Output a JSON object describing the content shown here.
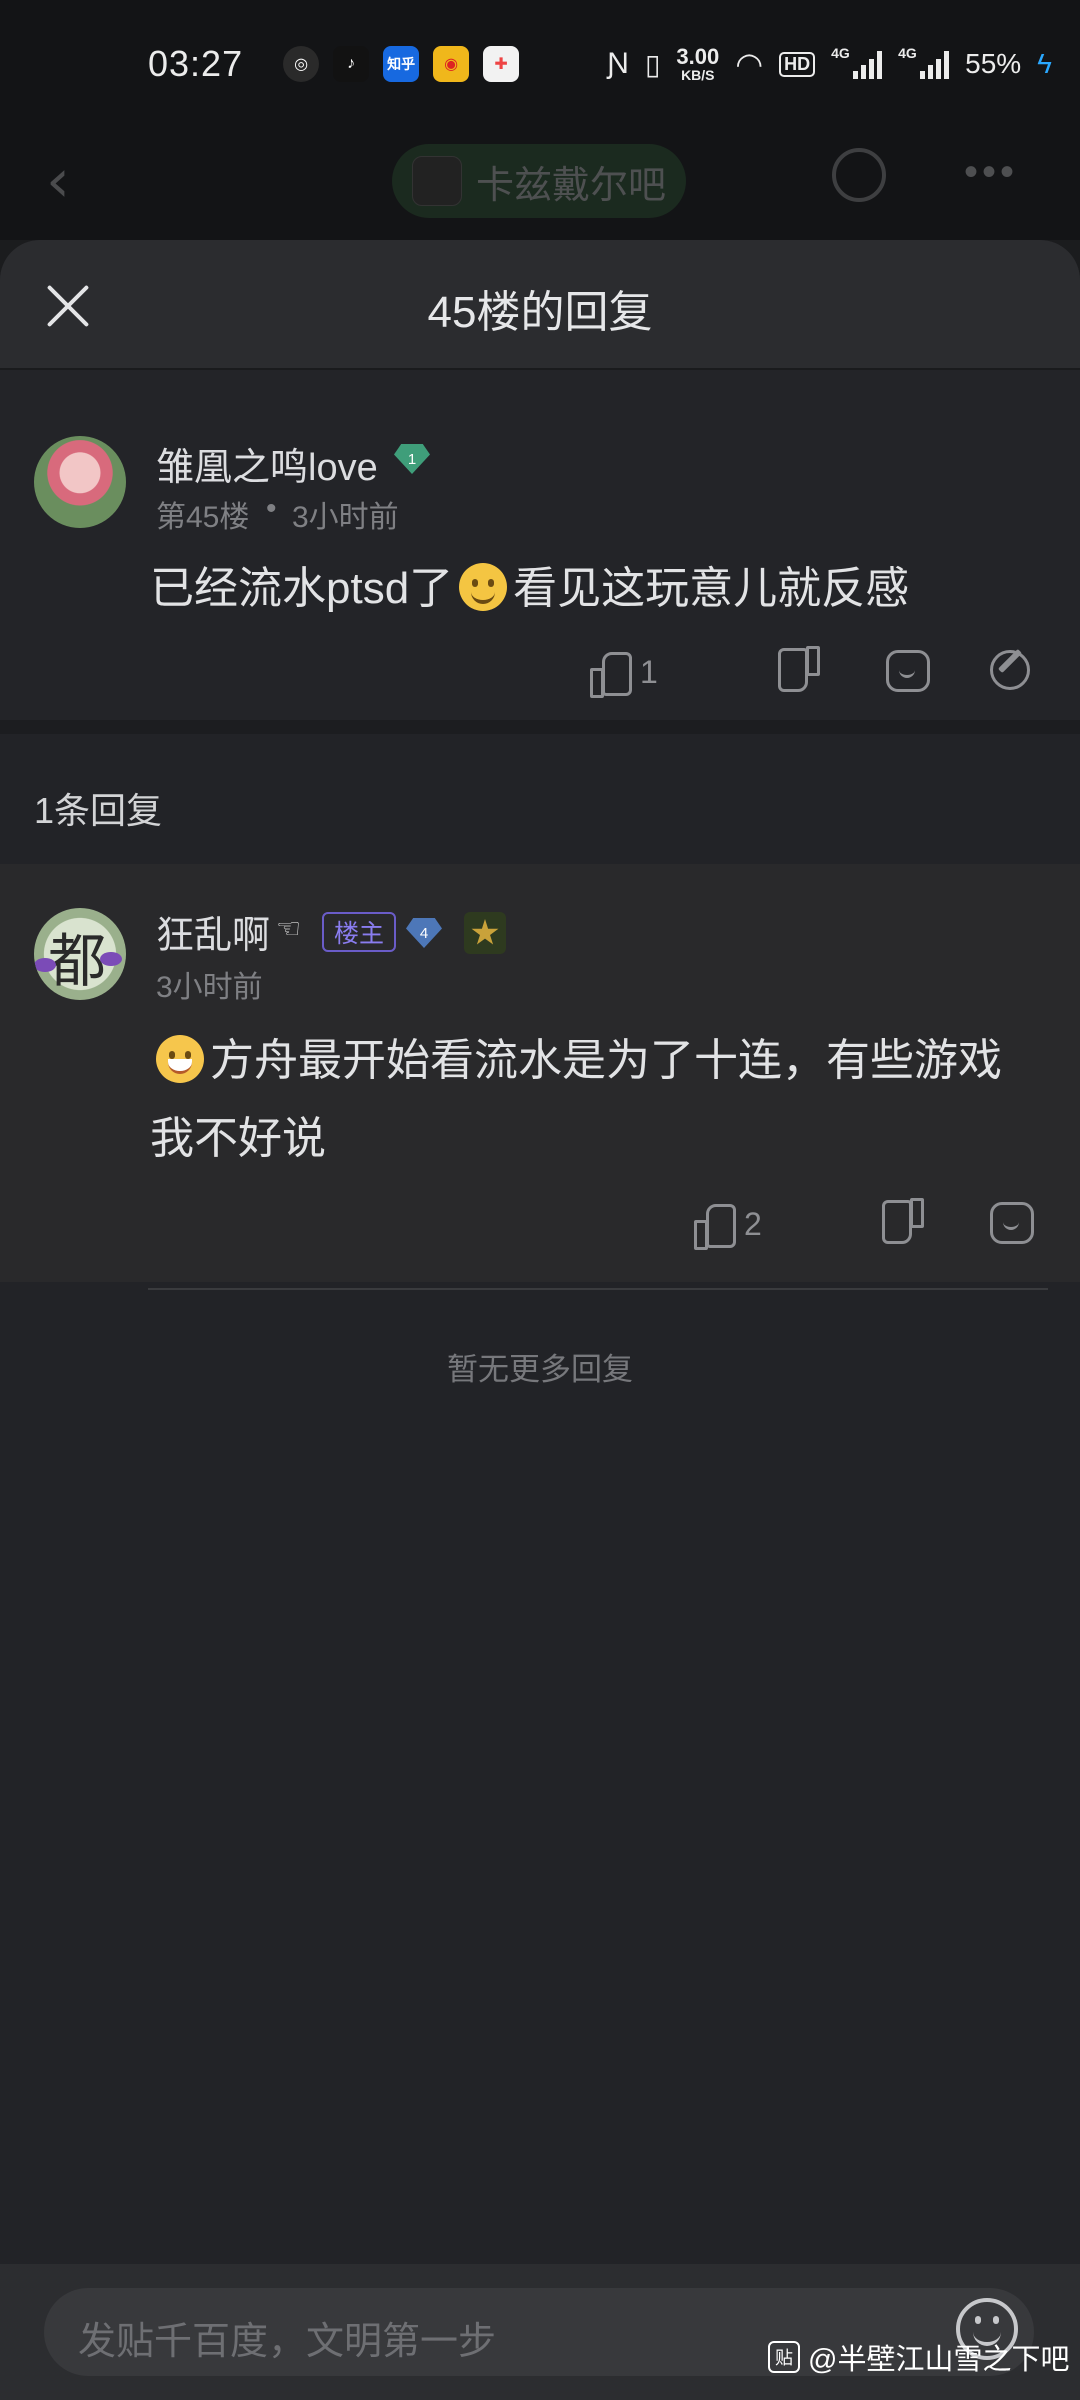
{
  "status_bar": {
    "time": "03:27",
    "net_speed_value": "3.00",
    "net_speed_unit": "KB/S",
    "hd_label": "HD",
    "signal1_label": "4G",
    "signal2_label": "4G",
    "battery": "55%",
    "app_icons": [
      "netease-music-icon",
      "tiktok-icon",
      "zhihu-icon",
      "weibo-icon",
      "game-center-icon"
    ],
    "zhihu_label": "知乎"
  },
  "underlying_header": {
    "forum_name": "卡兹戴尔吧"
  },
  "sheet": {
    "title": "45楼的回复"
  },
  "main_post": {
    "username": "雏凰之鸣love",
    "level": "1",
    "floor": "第45楼",
    "separator": "•",
    "time": "3小时前",
    "content_before": "已经流水ptsd了",
    "content_after": "看见这玩意儿就反感",
    "like_count": "1"
  },
  "reply_count_label": "1条回复",
  "reply": {
    "username": "狂乱啊",
    "point_icon": "☜",
    "owner_badge": "楼主",
    "level": "4",
    "time": "3小时前",
    "content": "方舟最开始看流水是为了十连，有些游戏我不好说",
    "like_count": "2"
  },
  "no_more_label": "暂无更多回复",
  "input": {
    "placeholder": "发贴千百度，文明第一步"
  },
  "watermark": {
    "logo_text": "贴",
    "text": "@半壁江山雪之下吧"
  },
  "colors": {
    "background": "#1b1c1e",
    "sheet": "#222327",
    "owner_badge": "#6a5cc8",
    "level_gem_green": "#3f9e7a",
    "level_gem_blue": "#4d77b8"
  }
}
